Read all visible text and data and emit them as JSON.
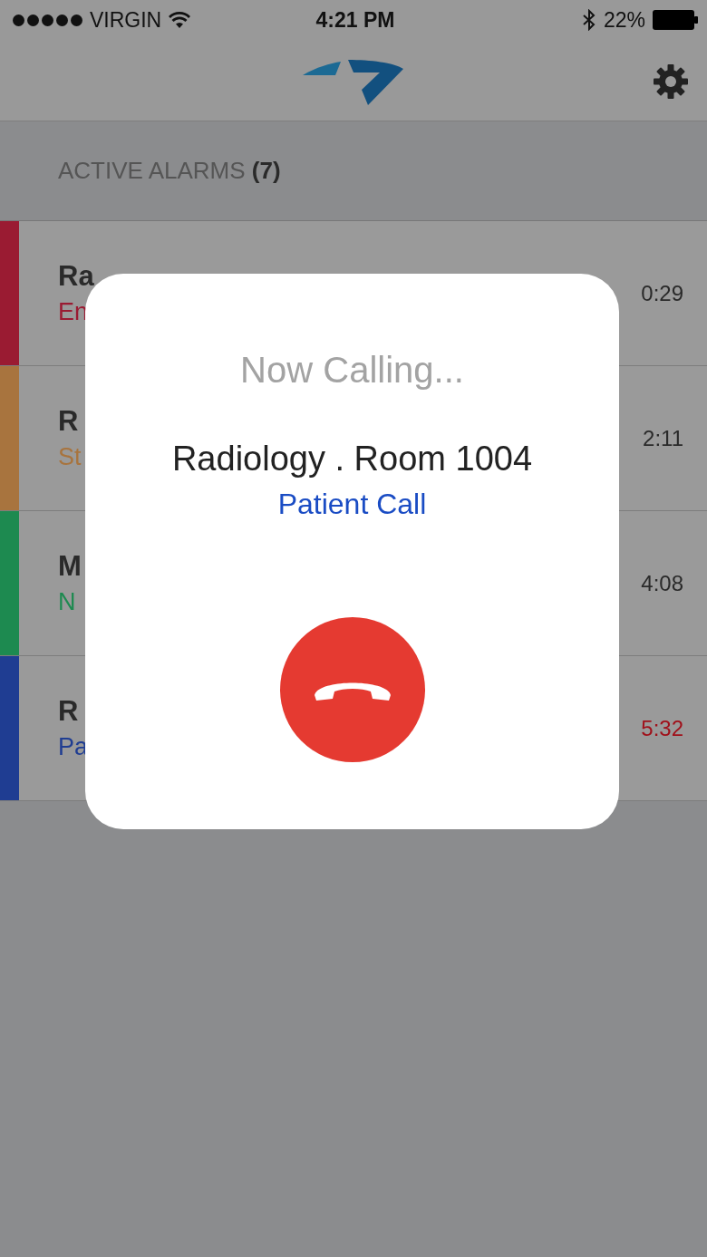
{
  "status_bar": {
    "carrier": "VIRGIN",
    "time": "4:21 PM",
    "battery": "22%"
  },
  "section": {
    "title": "ACTIVE ALARMS",
    "count": "(7)"
  },
  "alarms": [
    {
      "title": "Ra",
      "subtitle": "En",
      "time": "0:29",
      "color": "#9a1b32",
      "overdue": false
    },
    {
      "title": "R",
      "subtitle": "St",
      "time": "2:11",
      "color": "#a8743e",
      "overdue": false
    },
    {
      "title": "M",
      "subtitle": "N",
      "time": "4:08",
      "color": "#1d8a50",
      "overdue": false
    },
    {
      "title": "R",
      "subtitle": "Pa",
      "time": "5:32",
      "color": "#1f3d92",
      "overdue": true
    }
  ],
  "dialog": {
    "heading": "Now Calling...",
    "location": "Radiology . Room 1004",
    "call_type": "Patient Call"
  }
}
